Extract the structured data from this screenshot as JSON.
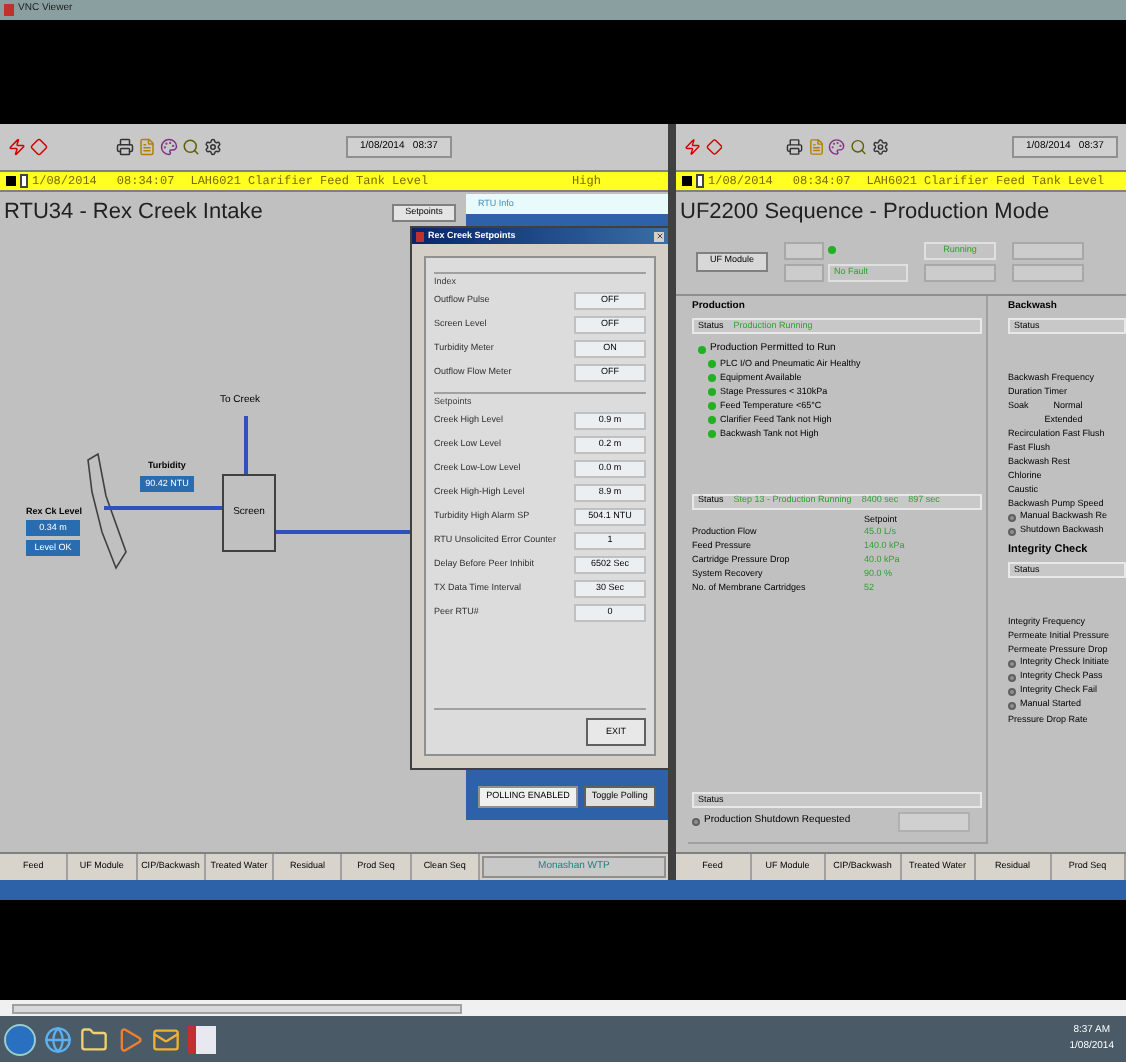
{
  "vnc_title": "VNC Viewer",
  "left_screen": {
    "toolbar_datetime": "1/08/2014   08:37",
    "alarm": {
      "date": "1/08/2014",
      "time": "08:34:07",
      "text": "LAH6021 Clarifier Feed Tank Level",
      "priority": "High"
    },
    "title": "RTU34 - Rex Creek Intake",
    "setpoints_button": "Setpoints",
    "rtu_info_tab": "RTU Info",
    "diagram": {
      "to_creek": "To Creek",
      "screen": "Screen",
      "turbidity_label": "Turbidity",
      "turbidity_value": "90.42 NTU",
      "level_label": "Rex Ck Level",
      "level_value": "0.34 m",
      "level_status": "Level OK"
    },
    "dialog": {
      "title": "Rex Creek Setpoints",
      "groups": [
        {
          "title": "Index",
          "rows": [
            {
              "label": "Outflow Pulse",
              "value": "OFF"
            },
            {
              "label": "Screen Level",
              "value": "OFF"
            },
            {
              "label": "Turbidity Meter",
              "value": "ON"
            },
            {
              "label": "Outflow Flow Meter",
              "value": "OFF"
            }
          ]
        },
        {
          "title": "Setpoints",
          "rows": [
            {
              "label": "Creek High Level",
              "value": "0.9 m"
            },
            {
              "label": "Creek Low Level",
              "value": "0.2 m"
            },
            {
              "label": "Creek Low-Low Level",
              "value": "0.0 m"
            },
            {
              "label": "Creek High-High Level",
              "value": "8.9 m"
            },
            {
              "label": "Turbidity High Alarm SP",
              "value": "504.1 NTU"
            },
            {
              "label": "RTU Unsolicited Error Counter",
              "value": "1"
            },
            {
              "label": "Delay Before Peer Inhibit",
              "value": "6502 Sec"
            },
            {
              "label": "TX Data Time Interval",
              "value": "30 Sec"
            },
            {
              "label": "Peer RTU#",
              "value": "0"
            }
          ]
        }
      ],
      "exit_button": "EXIT"
    },
    "polling_status": "POLLING ENABLED",
    "toggle_button": "Toggle Polling",
    "nav": [
      "Feed",
      "UF Module",
      "CIP/Backwash",
      "Treated Water",
      "Residual",
      "Prod Seq",
      "Clean Seq"
    ],
    "site_label": "Monashan WTP"
  },
  "right_screen": {
    "toolbar_datetime": "1/08/2014   08:37",
    "alarm": {
      "date": "1/08/2014",
      "time": "08:34:07",
      "text": "LAH6021 Clarifier Feed Tank Level"
    },
    "title": "UF2200 Sequence - Production Mode",
    "uf_module_button": "UF Module",
    "fault_field": "No Fault",
    "fault_ok": true,
    "state_field": "Running",
    "production": {
      "heading": "Production",
      "status_label": "Status",
      "status_value": "Production Running",
      "permit": {
        "text": "Production Permitted to Run",
        "ok": true,
        "children": [
          {
            "text": "PLC I/O and Pneumatic Air Healthy",
            "ok": true
          },
          {
            "text": "Equipment Available",
            "ok": true
          },
          {
            "text": "Stage Pressures < 310kPa",
            "ok": true
          },
          {
            "text": "Feed Temperature <65°C",
            "ok": true
          },
          {
            "text": "Clarifier Feed Tank not High",
            "ok": true
          },
          {
            "text": "Backwash Tank not High",
            "ok": true
          }
        ]
      },
      "step": {
        "label": "Status",
        "value": "Step 13 - Production Running",
        "timer_1": "8400 sec",
        "timer_2": "897 sec"
      },
      "setpoint_heading": "Setpoint",
      "params": [
        {
          "label": "Production Flow",
          "value": "45.0 L/s"
        },
        {
          "label": "Feed Pressure",
          "value": "140.0 kPa"
        },
        {
          "label": "Cartridge Pressure Drop",
          "value": "40.0 kPa"
        },
        {
          "label": "System Recovery",
          "value": "90.0 %"
        },
        {
          "label": "No. of Membrane Cartridges",
          "value": "52"
        }
      ],
      "shutdown_status_label": "Status",
      "shutdown": {
        "text": "Production Shutdown Requested",
        "on": false
      }
    },
    "backwash": {
      "heading": "Backwash",
      "status_label": "Status",
      "rows": [
        {
          "kind": "label",
          "label": "Backwash Frequency"
        },
        {
          "kind": "label",
          "label": "Duration Timer"
        },
        {
          "kind": "label",
          "label": "Soak",
          "values": [
            "Normal",
            "Extended"
          ]
        },
        {
          "kind": "label",
          "label": "Recirculation Fast Flush"
        },
        {
          "kind": "label",
          "label": "Fast Flush"
        },
        {
          "kind": "label",
          "label": "Backwash Rest"
        },
        {
          "kind": "label",
          "label": "Chlorine"
        },
        {
          "kind": "label",
          "label": "Caustic"
        },
        {
          "kind": "label",
          "label": "Backwash Pump Speed"
        },
        {
          "kind": "indicator",
          "label": "Manual Backwash Re",
          "on": false
        },
        {
          "kind": "indicator",
          "label": "Shutdown Backwash",
          "on": false
        }
      ]
    },
    "integrity": {
      "heading": "Integrity Check",
      "status_label": "Status",
      "rows": [
        {
          "kind": "label",
          "label": "Integrity Frequency"
        },
        {
          "kind": "label",
          "label": "Permeate Initial Pressure"
        },
        {
          "kind": "label",
          "label": "Permeate Pressure Drop"
        },
        {
          "kind": "indicator",
          "label": "Integrity Check Initiate",
          "on": false
        },
        {
          "kind": "indicator",
          "label": "Integrity Check Pass",
          "on": false
        },
        {
          "kind": "indicator",
          "label": "Integrity Check Fail",
          "on": false
        },
        {
          "kind": "indicator",
          "label": "Manual Started",
          "on": false
        },
        {
          "kind": "label",
          "label": "Pressure Drop Rate"
        }
      ]
    },
    "nav": [
      "Feed",
      "UF Module",
      "CIP/Backwash",
      "Treated Water",
      "Residual",
      "Prod Seq"
    ]
  },
  "taskbar": {
    "time": "8:37 AM",
    "date": "1/08/2014"
  }
}
